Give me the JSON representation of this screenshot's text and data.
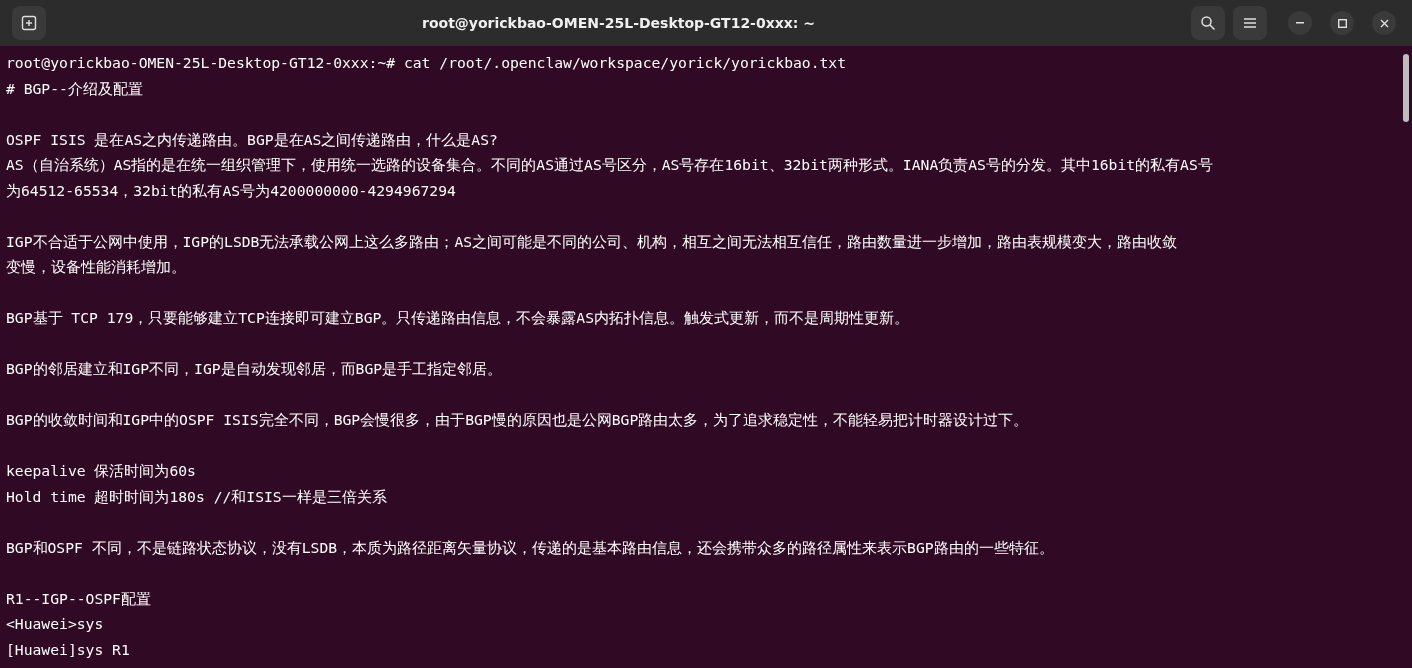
{
  "window": {
    "title": "root@yorickbao-OMEN-25L-Desktop-GT12-0xxx: ~"
  },
  "terminal": {
    "paragraphs": [
      [
        "root@yorickbao-OMEN-25L-Desktop-GT12-0xxx:~# cat /root/.openclaw/workspace/yorick/yorickbao.txt",
        "# BGP--介绍及配置"
      ],
      [
        "OSPF ISIS 是在AS之内传递路由。BGP是在AS之间传递路由，什么是AS?",
        "AS（自治系统）AS指的是在统一组织管理下，使用统一选路的设备集合。不同的AS通过AS号区分，AS号存在16bit、32bit两种形式。IANA负责AS号的分发。其中16bit的私有AS号",
        "为64512-65534，32bit的私有AS号为4200000000-4294967294"
      ],
      [
        "IGP不合适于公网中使用，IGP的LSDB无法承载公网上这么多路由；AS之间可能是不同的公司、机构，相互之间无法相互信任，路由数量进一步增加，路由表规模变大，路由收敛",
        "变慢，设备性能消耗增加。"
      ],
      [
        "BGP基于 TCP 179，只要能够建立TCP连接即可建立BGP。只传递路由信息，不会暴露AS内拓扑信息。触发式更新，而不是周期性更新。"
      ],
      [
        "BGP的邻居建立和IGP不同，IGP是自动发现邻居，而BGP是手工指定邻居。"
      ],
      [
        "BGP的收敛时间和IGP中的OSPF ISIS完全不同，BGP会慢很多，由于BGP慢的原因也是公网BGP路由太多，为了追求稳定性，不能轻易把计时器设计过下。"
      ],
      [
        "keepalive 保活时间为60s",
        "Hold time 超时时间为180s //和ISIS一样是三倍关系"
      ],
      [
        "BGP和OSPF 不同，不是链路状态协议，没有LSDB，本质为路径距离矢量协议，传递的是基本路由信息，还会携带众多的路径属性来表示BGP路由的一些特征。"
      ],
      [
        "R1--IGP--OSPF配置",
        "<Huawei>sys",
        "[Huawei]sys R1"
      ]
    ]
  }
}
